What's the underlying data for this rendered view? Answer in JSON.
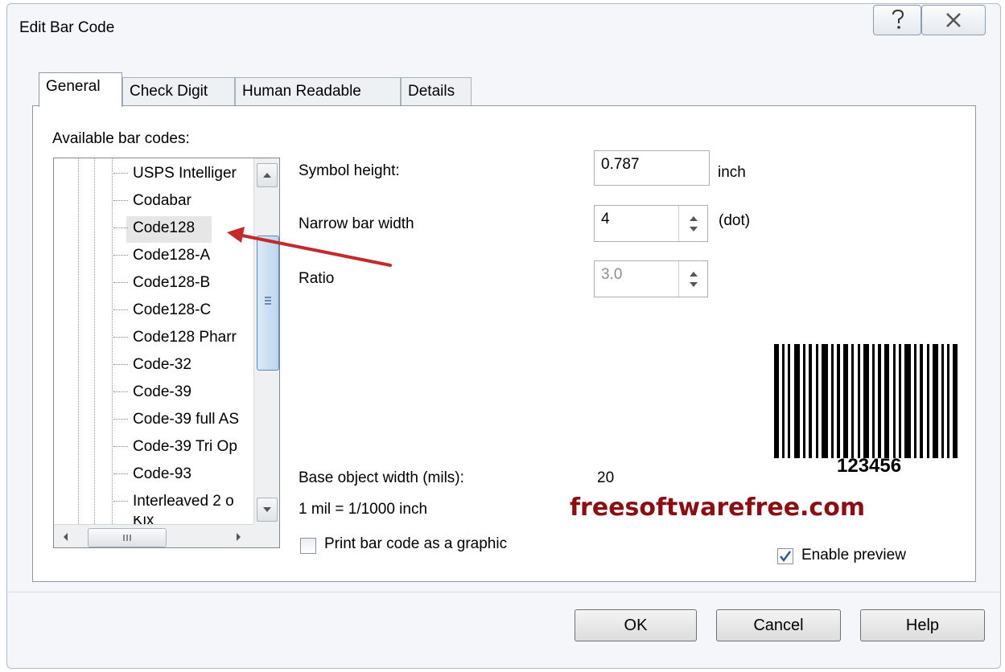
{
  "window": {
    "title": "Edit Bar Code",
    "help_icon": "question-mark",
    "close_icon": "close-x"
  },
  "tabs": [
    {
      "label": "General"
    },
    {
      "label": "Check Digit"
    },
    {
      "label": "Human Readable"
    },
    {
      "label": "Details"
    }
  ],
  "general": {
    "available_label": "Available bar codes:",
    "barcode_list": [
      "USPS Intelliger",
      "Codabar",
      "Code128",
      "Code128-A",
      "Code128-B",
      "Code128-C",
      "Code128 Pharr",
      "Code-32",
      "Code-39",
      "Code-39 full AS",
      "Code-39 Tri Op",
      "Code-93",
      "Interleaved 2 o",
      "Kix"
    ],
    "selected": "Code128",
    "symbol_height_label": "Symbol height:",
    "symbol_height_value": "0.787",
    "symbol_height_unit": "inch",
    "narrow_bar_label": "Narrow bar width",
    "narrow_bar_value": "4",
    "narrow_bar_unit": "(dot)",
    "ratio_label": "Ratio",
    "ratio_value": "3.0",
    "base_width_label": "Base object width (mils):",
    "base_width_value": "20",
    "mil_note": "1 mil = 1/1000 inch",
    "print_graphic_label": "Print bar code as a graphic",
    "print_graphic_checked": false,
    "enable_preview_label": "Enable preview",
    "enable_preview_checked": true,
    "preview_text": "123456"
  },
  "watermark": "freesoftwarefree.com",
  "buttons": {
    "ok": "OK",
    "cancel": "Cancel",
    "help": "Help"
  },
  "colors": {
    "watermark": "#8b0e12",
    "arrow": "#c42a2a",
    "selection": "#e6e6e6"
  }
}
